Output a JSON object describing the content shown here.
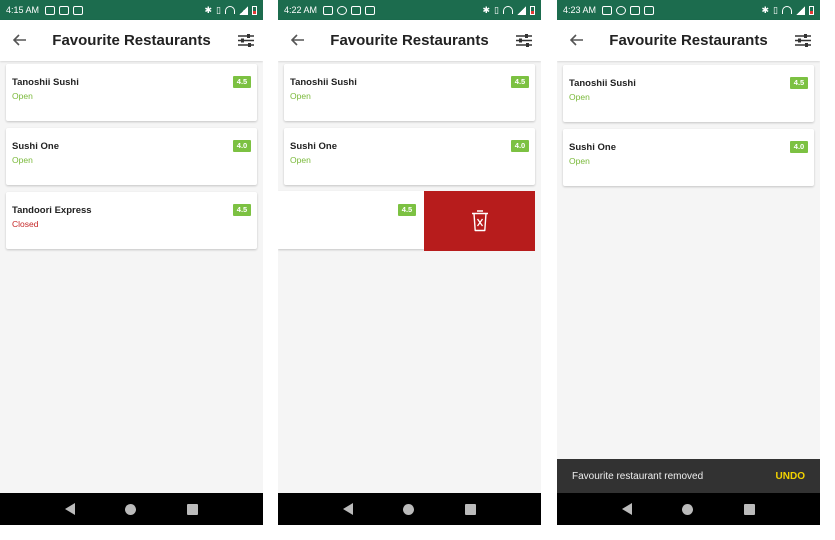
{
  "screens": [
    {
      "status_time": "4:15 AM",
      "title": "Favourite Restaurants",
      "restaurants": [
        {
          "name": "Tanoshii Sushi",
          "status": "Open",
          "rating": "4.5"
        },
        {
          "name": "Sushi One",
          "status": "Open",
          "rating": "4.0"
        },
        {
          "name": "Tandoori Express",
          "status": "Closed",
          "rating": "4.5"
        }
      ]
    },
    {
      "status_time": "4:22 AM",
      "title": "Favourite Restaurants",
      "restaurants": [
        {
          "name": "Tanoshii Sushi",
          "status": "Open",
          "rating": "4.5"
        },
        {
          "name": "Sushi One",
          "status": "Open",
          "rating": "4.0"
        }
      ],
      "swiping_item": {
        "rating": "4.5"
      }
    },
    {
      "status_time": "4:23 AM",
      "title": "Favourite Restaurants",
      "restaurants": [
        {
          "name": "Tanoshii Sushi",
          "status": "Open",
          "rating": "4.5"
        },
        {
          "name": "Sushi One",
          "status": "Open",
          "rating": "4.0"
        }
      ],
      "snackbar": {
        "message": "Favourite restaurant removed",
        "action": "UNDO"
      }
    }
  ],
  "colors": {
    "status_bar": "#1c6c4e",
    "rating_badge": "#7cc142",
    "open_text": "#7ab93a",
    "closed_text": "#c62828",
    "delete_background": "#b71c1c",
    "snackbar_action": "#f3d300"
  },
  "icons": {
    "back": "arrow-left-icon",
    "filter": "sliders-icon",
    "delete": "trash-icon"
  }
}
